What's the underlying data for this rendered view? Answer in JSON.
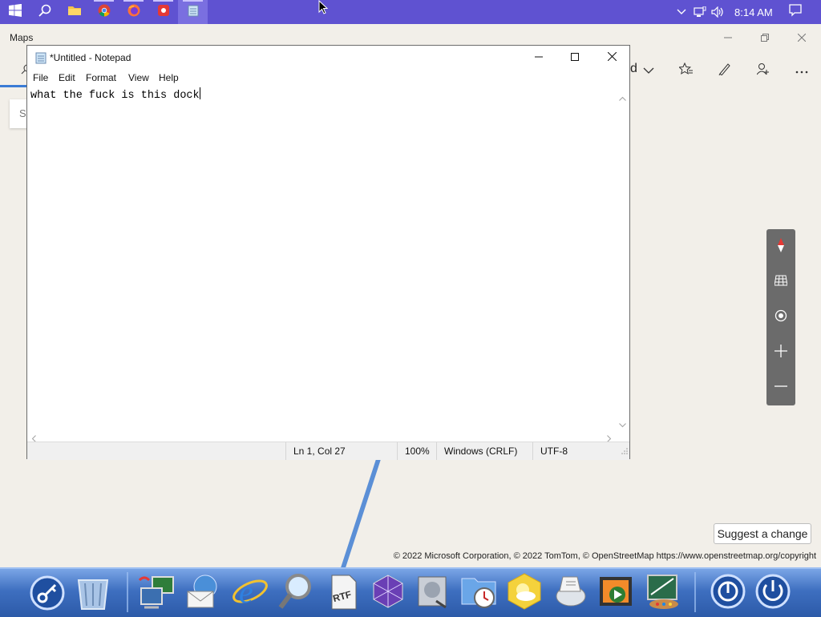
{
  "taskbar": {
    "clock": "8:14 AM",
    "apps": [
      "start",
      "search",
      "file-explorer",
      "chrome",
      "firefox",
      "app-red",
      "notepad"
    ]
  },
  "maps": {
    "title": "Maps",
    "toolbar_partial_label": "d",
    "search_partial": "S",
    "suggest_change": "Suggest a change",
    "copyright": "© 2022 Microsoft Corporation, © 2022 TomTom, © OpenStreetMap https://www.openstreetmap.org/copyright"
  },
  "notepad": {
    "title": "*Untitled - Notepad",
    "menu": [
      "File",
      "Edit",
      "Format",
      "View",
      "Help"
    ],
    "content": "what the fuck is this dock",
    "status": {
      "position": "Ln 1, Col 27",
      "zoom": "100%",
      "line_ending": "Windows (CRLF)",
      "encoding": "UTF-8"
    }
  },
  "colors": {
    "taskbar": "#5f52d1",
    "dock_top": "#7aa5e6",
    "dock_bottom": "#2c5aa8",
    "map_bg": "#f2efe9",
    "road": "#5b8fd6"
  },
  "dock": {
    "icons": [
      "keychain-icon",
      "trash-icon",
      "network-icon",
      "mail-icon",
      "internet-explorer-icon",
      "magnifier-icon",
      "rtf-document-icon",
      "cube-app-icon",
      "disk-utility-icon",
      "clock-folder-icon",
      "weather-icon",
      "media-icon",
      "video-icon",
      "paint-icon",
      "power-icon-1",
      "power-icon-2"
    ]
  }
}
